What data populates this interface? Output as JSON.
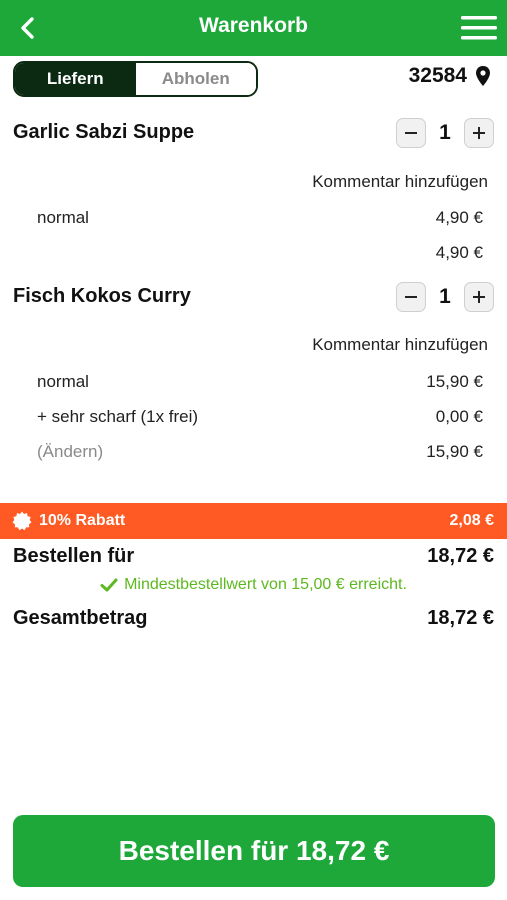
{
  "header": {
    "title": "Warenkorb",
    "back_icon": "chevron-left-icon",
    "menu_icon": "hamburger-menu-icon",
    "color": "#1ea83a"
  },
  "delivery_toggle": {
    "options": [
      "Liefern",
      "Abholen"
    ],
    "selected": "Liefern"
  },
  "location": {
    "zip": "32584",
    "icon": "map-pin-icon"
  },
  "items": [
    {
      "name": "Garlic Sabzi Suppe",
      "quantity": "1",
      "comment_link": "Kommentar hinzufügen",
      "lines": [
        {
          "label": "normal",
          "price": "4,90 €"
        }
      ],
      "total": "4,90 €"
    },
    {
      "name": "Fisch Kokos Curry",
      "quantity": "1",
      "comment_link": "Kommentar hinzufügen",
      "lines": [
        {
          "label": "normal",
          "price": "15,90 €"
        },
        {
          "label": "+ sehr scharf (1x frei)",
          "price": "0,00 €"
        }
      ],
      "change_link": "(Ändern)",
      "total": "15,90 €"
    }
  ],
  "discount": {
    "label": "10% Rabatt",
    "amount": "2,08 €",
    "color": "#ff5a24",
    "icon": "badge-icon"
  },
  "order_for": {
    "label": "Bestellen für",
    "value": "18,72 €"
  },
  "min_order_note": {
    "text": "Mindestbestellwert von 15,00 € erreicht.",
    "icon": "check-icon",
    "color": "#5db81f"
  },
  "total": {
    "label": "Gesamtbetrag",
    "value": "18,72 €"
  },
  "cta": {
    "label": "Bestellen für 18,72 €"
  }
}
